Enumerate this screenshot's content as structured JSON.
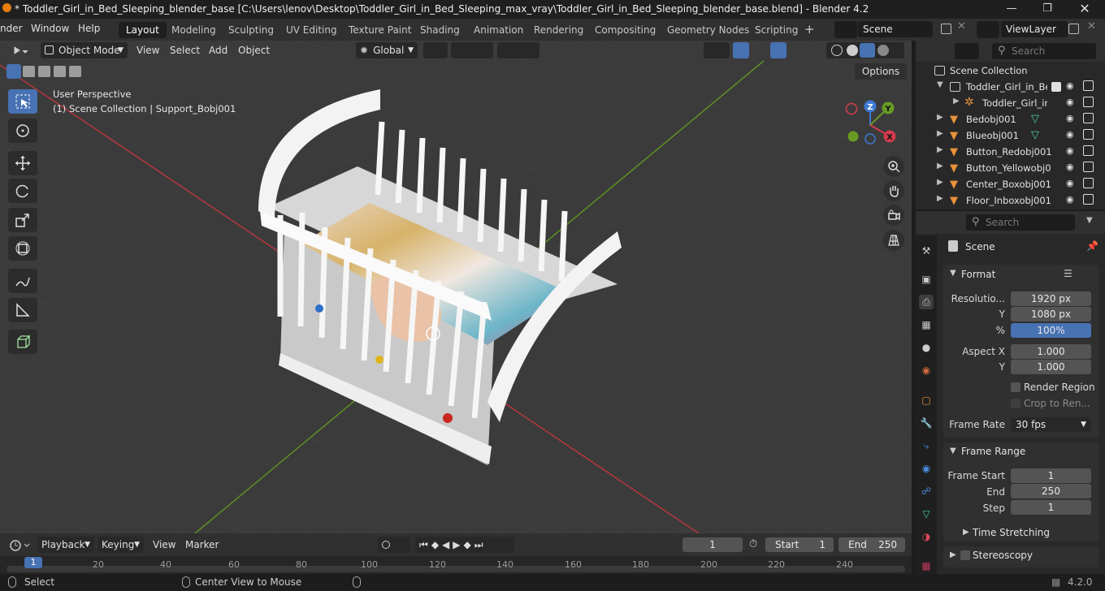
{
  "title": "* Toddler_Girl_in_Bed_Sleeping_blender_base [C:\\Users\\lenov\\Desktop\\Toddler_Girl_in_Bed_Sleeping_max_vray\\Toddler_Girl_in_Bed_Sleeping_blender_base.blend] - Blender 4.2",
  "menus": [
    "nder",
    "Window",
    "Help"
  ],
  "workspaces": [
    "Layout",
    "Modeling",
    "Sculpting",
    "UV Editing",
    "Texture Paint",
    "Shading",
    "Animation",
    "Rendering",
    "Compositing",
    "Geometry Nodes",
    "Scripting"
  ],
  "scene_name": "Scene",
  "view_layer": "ViewLayer",
  "viewport": {
    "mode": "Object Mode",
    "menus": [
      "View",
      "Select",
      "Add",
      "Object"
    ],
    "orientation": "Global",
    "options_label": "Options",
    "perspective": "User Perspective",
    "active_info": "(1) Scene Collection | Support_Bobj001",
    "gizmo": {
      "z": "Z",
      "y": "Y",
      "x": "X"
    }
  },
  "outliner": {
    "search_placeholder": "Search",
    "root": "Scene Collection",
    "items": [
      "Toddler_Girl_in_Bed",
      "Toddler_Girl_in_",
      "Bedobj001",
      "Blueobj001",
      "Button_Redobj001",
      "Button_Yellowobj0",
      "Center_Boxobj001",
      "Floor_Inboxobj001"
    ]
  },
  "properties": {
    "search_placeholder": "Search",
    "context": "Scene",
    "format_label": "Format",
    "resolution_label": "Resolutio...",
    "res_x": "1920 px",
    "y_label": "Y",
    "res_y": "1080 px",
    "pct_label": "%",
    "res_pct": "100%",
    "aspect_label": "Aspect X",
    "aspect_x": "1.000",
    "aspect_y": "1.000",
    "render_region": "Render Region",
    "crop": "Crop to Ren...",
    "frame_rate_label": "Frame Rate",
    "frame_rate": "30 fps",
    "frame_range_label": "Frame Range",
    "frame_start_label": "Frame Start",
    "frame_start": "1",
    "end_label": "End",
    "frame_end": "250",
    "step_label": "Step",
    "frame_step": "1",
    "time_stretching": "Time Stretching",
    "stereoscopy": "Stereoscopy"
  },
  "timeline": {
    "menus": [
      "Playback",
      "Keying",
      "View",
      "Marker"
    ],
    "current_frame": "1",
    "start_label": "Start",
    "start": "1",
    "end_label": "End",
    "end": "250",
    "ticks": [
      "1",
      "20",
      "40",
      "60",
      "80",
      "100",
      "120",
      "140",
      "160",
      "180",
      "200",
      "220",
      "240"
    ]
  },
  "status": {
    "select": "Select",
    "center_view": "Center View to Mouse",
    "version": "4.2.0"
  },
  "colors": {
    "accent": "#4772b3",
    "axis_x": "#d33b4c",
    "axis_y": "#6a9a24",
    "axis_z": "#3d78d5",
    "object_orange": "#e8913b",
    "mesh_green": "#4fd0a0"
  }
}
